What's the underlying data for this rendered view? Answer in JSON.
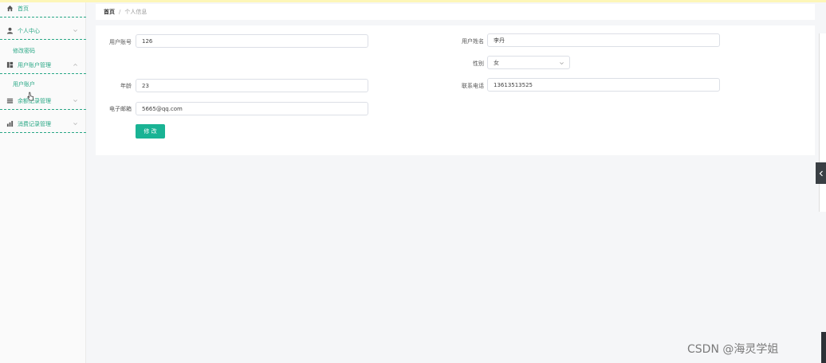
{
  "sidebar": {
    "items": [
      {
        "label": "首页"
      },
      {
        "label": "个人中心",
        "sub": [
          "修改密码"
        ]
      },
      {
        "label": "用户账户管理",
        "sub": [
          "用户账户"
        ]
      },
      {
        "label": "余额记录管理"
      },
      {
        "label": "消费记录管理"
      }
    ]
  },
  "breadcrumb": {
    "home": "首页",
    "separator": "/",
    "current": "个人信息"
  },
  "form": {
    "account_label": "用户账号",
    "account_value": "126",
    "name_label": "用户姓名",
    "name_value": "李丹",
    "gender_label": "性别",
    "gender_value": "女",
    "age_label": "年龄",
    "age_value": "23",
    "phone_label": "联系电话",
    "phone_value": "13613513525",
    "email_label": "电子邮箱",
    "email_value": "5665@qq.com",
    "submit_label": "修 改"
  },
  "watermark": "CSDN @海灵学姐",
  "colors": {
    "accent": "#19b394",
    "menu_text": "#2aa886",
    "collapse_tab": "#3a3f44"
  }
}
